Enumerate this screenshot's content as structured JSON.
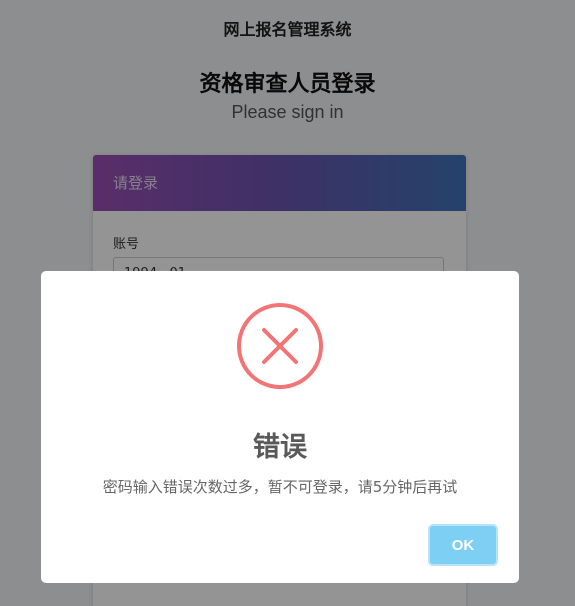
{
  "header": {
    "system_title": "网上报名管理系统",
    "login_title": "资格审查人员登录",
    "login_subtitle": "Please sign in"
  },
  "login_panel": {
    "heading": "请登录",
    "account_label": "账号",
    "account_value": "1994...01"
  },
  "dialog": {
    "icon": "error-x-icon",
    "title": "错误",
    "message": "密码输入错误次数过多，暂不可登录，请5分钟后再试",
    "ok_label": "OK"
  },
  "colors": {
    "error_red": "#f27474",
    "ok_button": "#7ecff4",
    "panel_gradient_start": "#9b4fb5",
    "panel_gradient_end": "#3f73b8"
  }
}
